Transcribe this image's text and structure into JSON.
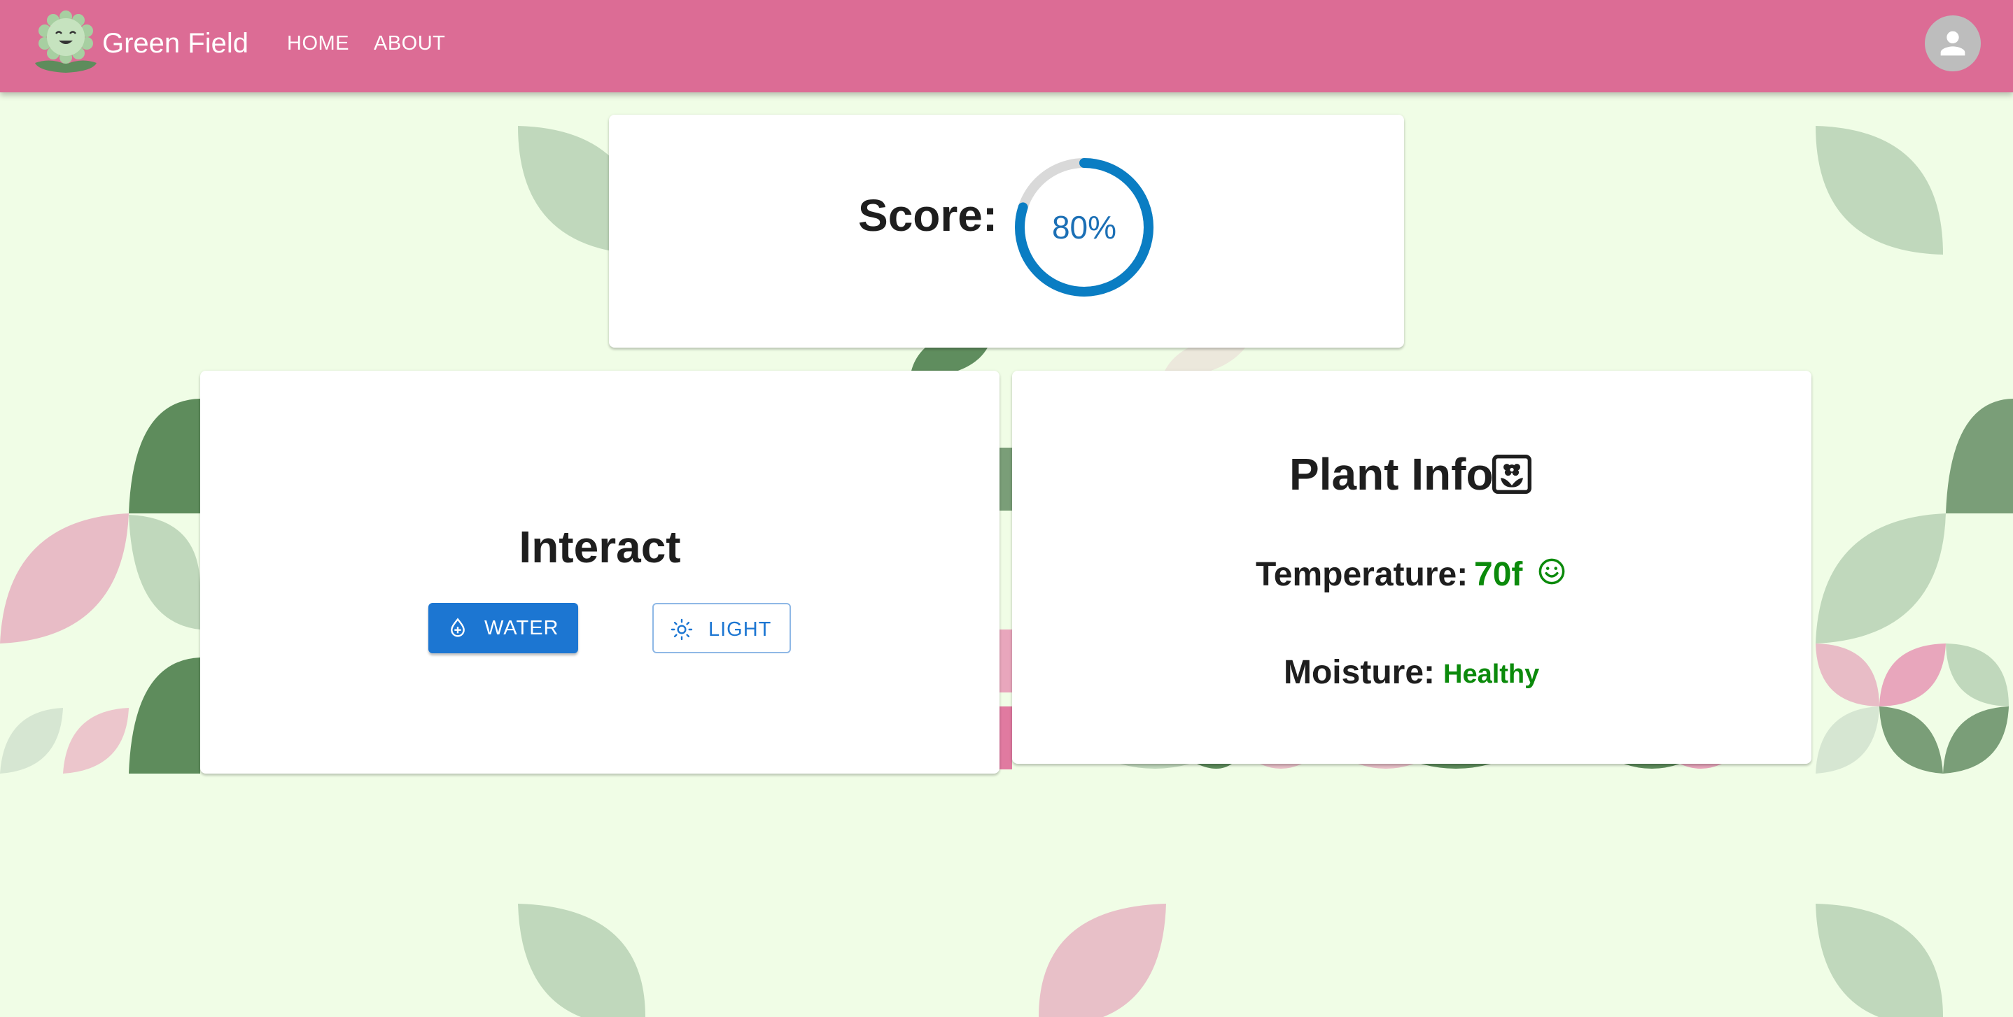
{
  "app": {
    "title": "Green Field",
    "colors": {
      "header": "#dc6c95",
      "background": "#f0fde6",
      "primary": "#1c76d2",
      "healthy": "#0b8a0b"
    }
  },
  "nav": {
    "home_label": "HOME",
    "about_label": "ABOUT"
  },
  "icons": {
    "logo": "smiling-flower-icon",
    "avatar": "person-icon",
    "water": "water-drop-icon",
    "light": "sun-icon",
    "plant": "potted-flower-icon",
    "temperature_status": "smiley-face-icon"
  },
  "score": {
    "label": "Score:",
    "value_text": "80%",
    "percent": 80
  },
  "interact": {
    "title": "Interact",
    "water_label": "WATER",
    "light_label": "LIGHT"
  },
  "plant_info": {
    "title": "Plant Info",
    "temperature_label": "Temperature:",
    "temperature_value": "70f",
    "moisture_label": "Moisture:",
    "moisture_value": "Healthy"
  }
}
